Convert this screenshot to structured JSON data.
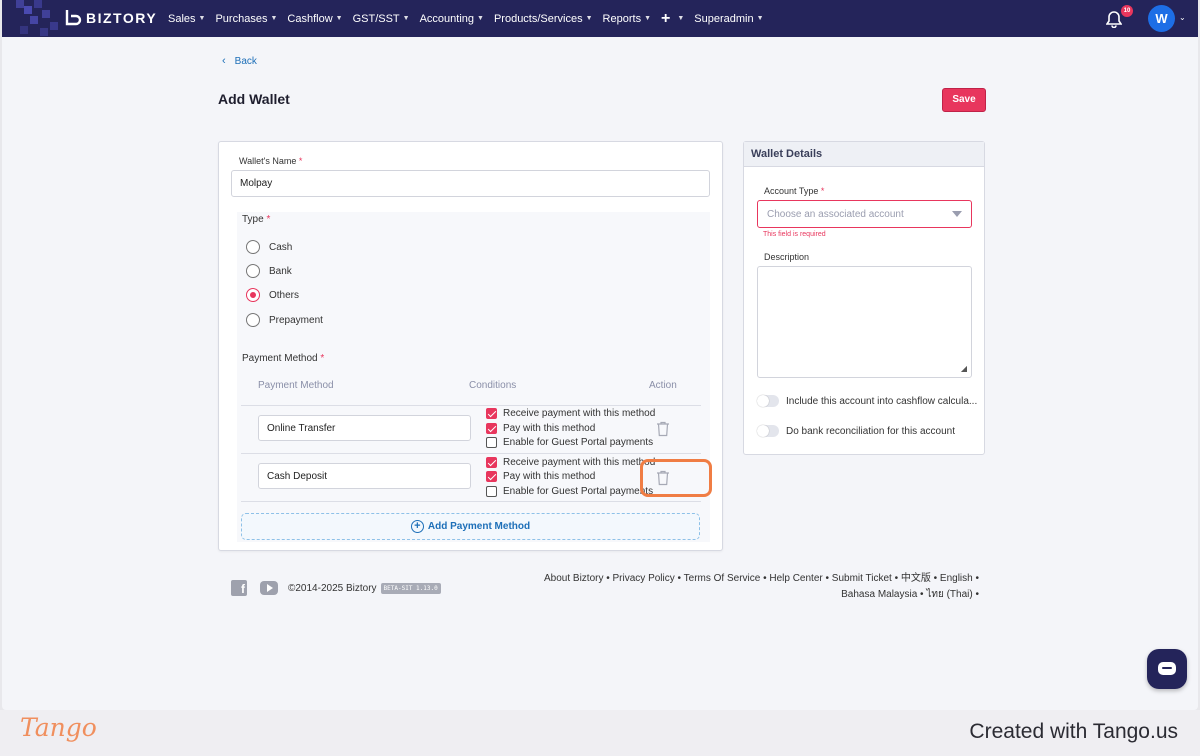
{
  "navbar": {
    "brand": "BIZTORY",
    "menu": [
      {
        "label": "Sales"
      },
      {
        "label": "Purchases"
      },
      {
        "label": "Cashflow"
      },
      {
        "label": "GST/SST"
      },
      {
        "label": "Accounting"
      },
      {
        "label": "Products/Services"
      },
      {
        "label": "Reports"
      }
    ],
    "plus_label": "+",
    "superadmin_label": "Superadmin",
    "notification_count": "10",
    "avatar_initial": "W"
  },
  "header": {
    "back_label": "Back",
    "title": "Add Wallet",
    "save_label": "Save"
  },
  "form": {
    "wallet_name_label": "Wallet's Name",
    "wallet_name_value": "Molpay",
    "type_label": "Type",
    "type_options": [
      {
        "label": "Cash",
        "checked": false
      },
      {
        "label": "Bank",
        "checked": false
      },
      {
        "label": "Others",
        "checked": true
      },
      {
        "label": "Prepayment",
        "checked": false
      }
    ],
    "payment_method_label": "Payment Method",
    "table_headers": {
      "method": "Payment Method",
      "conditions": "Conditions",
      "action": "Action"
    },
    "payment_methods": [
      {
        "name": "Online Transfer",
        "conditions": [
          {
            "label": "Receive payment with this method",
            "checked": true
          },
          {
            "label": "Pay with this method",
            "checked": true
          },
          {
            "label": "Enable for Guest Portal payments",
            "checked": false
          }
        ]
      },
      {
        "name": "Cash Deposit",
        "conditions": [
          {
            "label": "Receive payment with this method",
            "checked": true
          },
          {
            "label": "Pay with this method",
            "checked": true
          },
          {
            "label": "Enable for Guest Portal payments",
            "checked": false
          }
        ]
      }
    ],
    "add_payment_label": "Add Payment Method",
    "required_mark": "*"
  },
  "wallet_details": {
    "title": "Wallet Details",
    "account_type_label": "Account Type",
    "account_type_placeholder": "Choose an associated account",
    "error_text": "This field is required",
    "description_label": "Description",
    "toggle_cashflow": "Include this account into cashflow calcula...",
    "toggle_reconcile": "Do bank reconciliation for this account"
  },
  "footer": {
    "copyright": "©2014-2025 Biztory",
    "beta": "BETA-SIT 1.13.0",
    "links_line1": "About Biztory • Privacy Policy • Terms Of Service • Help Center • Submit Ticket • 中文版 • English •",
    "links_line2": "Bahasa Malaysia • ไทย (Thai) •"
  },
  "tango": {
    "logo": "Tango",
    "created": "Created with Tango.us"
  },
  "colors": {
    "navbar": "#24245a",
    "accent": "#e8365d",
    "link": "#1d6fb8",
    "highlight": "#f07d44"
  }
}
